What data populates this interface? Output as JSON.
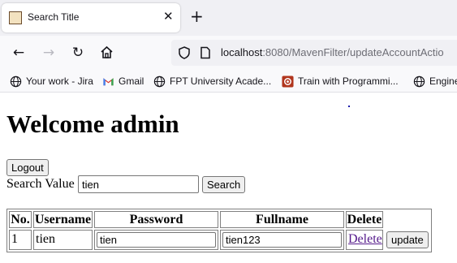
{
  "browser": {
    "tab_title": "Search Title",
    "url_host": "localhost",
    "url_rest": ":8080/MavenFilter/updateAccountActio",
    "bookmarks": [
      {
        "label": "Your work - Jira",
        "icon": "globe-icon"
      },
      {
        "label": "Gmail",
        "icon": "gmail-icon"
      },
      {
        "label": "FPT University Acade...",
        "icon": "globe-icon"
      },
      {
        "label": "Train with Programmi...",
        "icon": "codewars-icon"
      },
      {
        "label": "Engine",
        "icon": "globe-icon"
      }
    ]
  },
  "page": {
    "heading": "Welcome admin",
    "logout_label": "Logout",
    "search_label": "Search Value",
    "search_value": "tien",
    "search_button": "Search",
    "table": {
      "headers": [
        "No.",
        "Username",
        "Password",
        "Fullname",
        "Delete"
      ],
      "rows": [
        {
          "no": "1",
          "username": "tien",
          "password": "tien",
          "fullname": "tien123",
          "delete": "Delete",
          "update": "update"
        }
      ]
    }
  }
}
